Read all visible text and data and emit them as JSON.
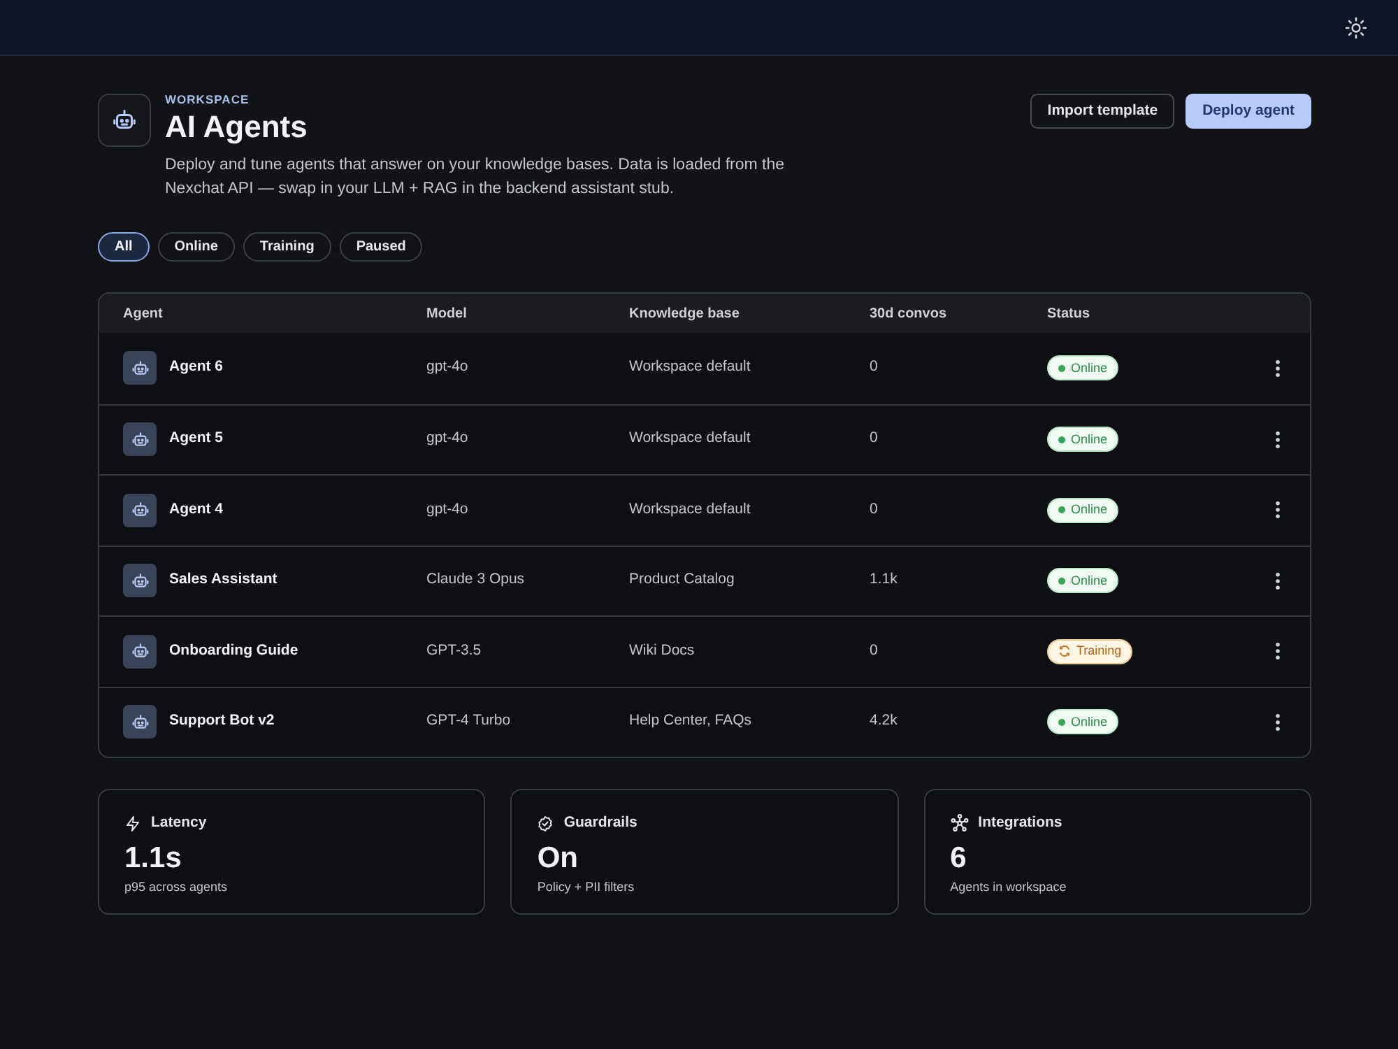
{
  "header": {
    "eyebrow": "WORKSPACE",
    "title": "AI Agents",
    "description": "Deploy and tune agents that answer on your knowledge bases. Data is loaded from the Nexchat API — swap in your LLM + RAG in the backend assistant stub.",
    "actions": [
      {
        "label": "Import template",
        "kind": "secondary"
      },
      {
        "label": "Deploy agent",
        "kind": "primary"
      }
    ]
  },
  "filters": [
    {
      "label": "All",
      "selected": true
    },
    {
      "label": "Online",
      "selected": false
    },
    {
      "label": "Training",
      "selected": false
    },
    {
      "label": "Paused",
      "selected": false
    }
  ],
  "table": {
    "columns": [
      "Agent",
      "Model",
      "Knowledge base",
      "30d convos",
      "Status"
    ],
    "rows": [
      {
        "agent": "Agent 6",
        "model": "gpt-4o",
        "knowledge_base": "Workspace default",
        "convos": "0",
        "status": {
          "label": "Online",
          "kind": "online"
        }
      },
      {
        "agent": "Agent 5",
        "model": "gpt-4o",
        "knowledge_base": "Workspace default",
        "convos": "0",
        "status": {
          "label": "Online",
          "kind": "online"
        }
      },
      {
        "agent": "Agent 4",
        "model": "gpt-4o",
        "knowledge_base": "Workspace default",
        "convos": "0",
        "status": {
          "label": "Online",
          "kind": "online"
        }
      },
      {
        "agent": "Sales Assistant",
        "model": "Claude 3 Opus",
        "knowledge_base": "Product Catalog",
        "convos": "1.1k",
        "status": {
          "label": "Online",
          "kind": "online"
        }
      },
      {
        "agent": "Onboarding Guide",
        "model": "GPT-3.5",
        "knowledge_base": "Wiki Docs",
        "convos": "0",
        "status": {
          "label": "Training",
          "kind": "training"
        }
      },
      {
        "agent": "Support Bot v2",
        "model": "GPT-4 Turbo",
        "knowledge_base": "Help Center, FAQs",
        "convos": "4.2k",
        "status": {
          "label": "Online",
          "kind": "online"
        }
      }
    ]
  },
  "stats": [
    {
      "kind": "latency",
      "title": "Latency",
      "value": "1.1s",
      "caption": "p95 across agents"
    },
    {
      "kind": "guardrails",
      "title": "Guardrails",
      "value": "On",
      "caption": "Policy + PII filters"
    },
    {
      "kind": "integrations",
      "title": "Integrations",
      "value": "6",
      "caption": "Agents in workspace"
    }
  ]
}
